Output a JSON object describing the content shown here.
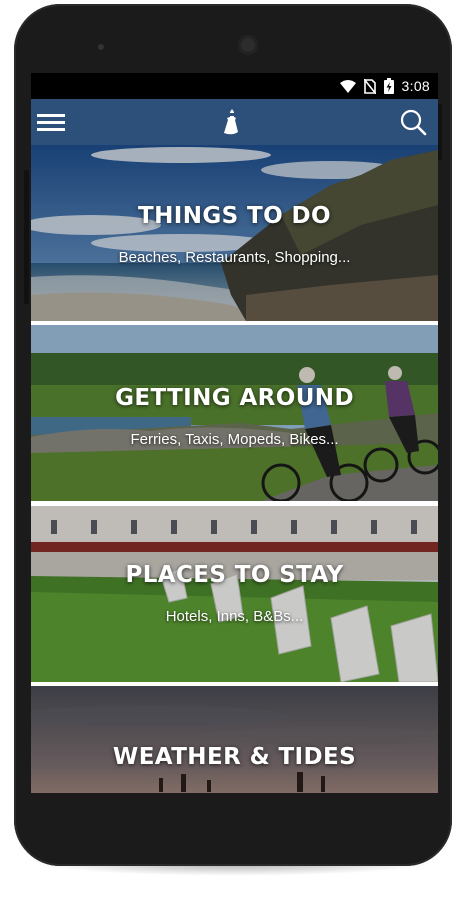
{
  "status_bar": {
    "time": "3:08",
    "icons": [
      "wifi-icon",
      "no-sim-icon",
      "battery-charging-icon"
    ]
  },
  "app_bar": {
    "menu_icon": "hamburger-menu-icon",
    "logo_icon": "lighthouse-logo-icon",
    "search_icon": "search-icon",
    "color": "#2c5079"
  },
  "cards": [
    {
      "title": "THINGS TO DO",
      "subtitle": "Beaches, Restaurants, Shopping..."
    },
    {
      "title": "GETTING AROUND",
      "subtitle": "Ferries, Taxis, Mopeds, Bikes..."
    },
    {
      "title": "PLACES TO STAY",
      "subtitle": "Hotels, Inns, B&Bs..."
    },
    {
      "title": "WEATHER & TIDES",
      "subtitle": ""
    }
  ]
}
